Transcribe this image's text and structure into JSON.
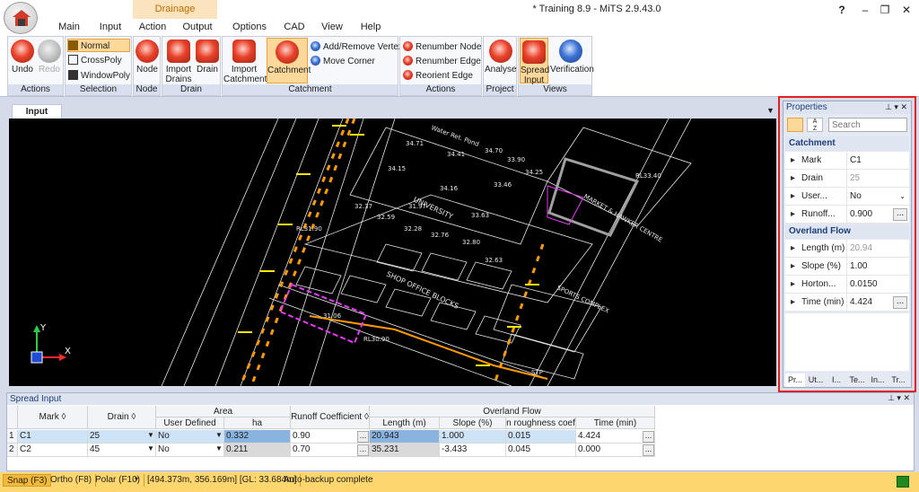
{
  "window": {
    "title": "* Training 8.9 - MiTS 2.9.43.0",
    "help": "?",
    "minimize": "–",
    "restore": "❐",
    "close": "✕"
  },
  "context_group": "Drainage",
  "tabs": [
    "Main",
    "Input",
    "Action",
    "Output",
    "Options",
    "CAD",
    "View",
    "Help"
  ],
  "ribbon": {
    "actions": {
      "label": "Actions",
      "undo": "Undo",
      "redo": "Redo"
    },
    "selection": {
      "label": "Selection",
      "normal": "Normal",
      "crosspoly": "CrossPoly",
      "windowpoly": "WindowPoly"
    },
    "node": {
      "label": "Node",
      "node": "Node"
    },
    "drain": {
      "label": "Drain",
      "import": "Import Drains",
      "drain": "Drain"
    },
    "catchment": {
      "label": "Catchment",
      "import": "Import Catchment",
      "catchment": "Catchment",
      "add_remove": "Add/Remove Vertex",
      "move_corner": "Move Corner"
    },
    "actions2": {
      "label": "Actions",
      "renumber_node": "Renumber Node",
      "renumber_edge": "Renumber Edge",
      "reorient_edge": "Reorient Edge"
    },
    "project": {
      "label": "Project",
      "analyse": "Analyse"
    },
    "views": {
      "label": "Views",
      "spread": "Spread Input",
      "verification": "Verification"
    }
  },
  "doc_tab": "Input",
  "properties": {
    "title": "Properties",
    "search_placeholder": "Search",
    "cat_catchment": "Catchment",
    "rows1": [
      {
        "name": "Mark",
        "value": "C1",
        "grey": false,
        "btn": false
      },
      {
        "name": "Drain",
        "value": "25",
        "grey": true,
        "btn": false
      },
      {
        "name": "User...",
        "value": "No",
        "grey": false,
        "btn": false
      },
      {
        "name": "Runoff...",
        "value": "0.900",
        "grey": false,
        "btn": true
      }
    ],
    "cat_overland": "Overland Flow",
    "rows2": [
      {
        "name": "Length (m)",
        "value": "20.94",
        "grey": true,
        "btn": false
      },
      {
        "name": "Slope (%)",
        "value": "1.00",
        "grey": false,
        "btn": false
      },
      {
        "name": "Horton...",
        "value": "0.0150",
        "grey": false,
        "btn": false
      },
      {
        "name": "Time (min)",
        "value": "4.424",
        "grey": false,
        "btn": true
      }
    ],
    "bottom_tabs": [
      "Pr...",
      "Ut...",
      "I...",
      "Te...",
      "In...",
      "Tr..."
    ]
  },
  "canvas_labels": [
    "Water Ret. Pond",
    "UNIVERSITY",
    "MARKET & HAWKER CENTRE",
    "SPORTS COMPLEX",
    "SHOP OFFICE BLOCKS",
    "STP",
    "RL31.90",
    "RL30.90",
    "RL33.40",
    "34.71",
    "34.41",
    "34.70",
    "34.15",
    "34.16",
    "33.46",
    "32.59",
    "32.76",
    "32.63",
    "32.80",
    "31.97",
    "32.37",
    "31.06",
    "32.28",
    "33.63",
    "33.90",
    "34.25"
  ],
  "axis": {
    "y": "Y",
    "x": "X"
  },
  "spread": {
    "title": "Spread Input",
    "headers": {
      "mark": "Mark",
      "drain": "Drain",
      "area": "Area",
      "user_defined": "User Defined",
      "ha": "ha",
      "runoff": "Runoff Coefficient",
      "overland": "Overland Flow",
      "length": "Length (m)",
      "slope": "Slope (%)",
      "n": "n roughness coef",
      "time": "Time (min)"
    },
    "rows": [
      {
        "num": "1",
        "mark": "C1",
        "drain": "25",
        "user": "No",
        "ha": "0.332",
        "runoff": "0.90",
        "length": "20.943",
        "slope": "1.000",
        "n": "0.015",
        "time": "4.424"
      },
      {
        "num": "2",
        "mark": "C2",
        "drain": "45",
        "user": "No",
        "ha": "0.211",
        "runoff": "0.70",
        "length": "35.231",
        "slope": "-3.433",
        "n": "0.045",
        "time": "0.000"
      }
    ]
  },
  "status": {
    "snap": "Snap (F3)",
    "ortho": "Ortho (F8)",
    "polar": "Polar (F10)",
    "coords": "[494.373m, 356.169m] [GL: 33.684m]",
    "message": "Auto-backup complete"
  }
}
